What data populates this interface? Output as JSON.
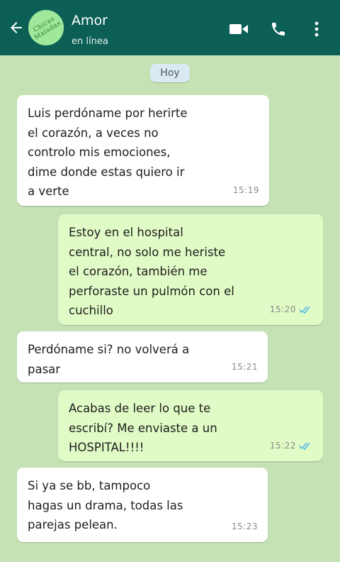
{
  "header": {
    "contact_name": "Amor",
    "status": "en línea",
    "avatar_text": "Chicas\nMaladas",
    "icons": {
      "back": "back-arrow-icon",
      "video": "video-call-icon",
      "phone": "phone-icon",
      "menu": "more-vert-icon"
    }
  },
  "day_label": "Hoy",
  "messages": [
    {
      "direction": "in",
      "text": "Luis perdóname por herirte\nel corazón, a veces no\ncontrolo mis emociones,\ndime donde estas quiero ir\na verte",
      "time": "15:19"
    },
    {
      "direction": "out",
      "text": "Estoy en el hospital\ncentral, no solo me heriste\nel corazón, también me\nperforaste un pulmón con el\ncuchillo",
      "time": "15:20",
      "read": true
    },
    {
      "direction": "in",
      "text": "Perdóname si? no volverá a\npasar",
      "time": "15:21"
    },
    {
      "direction": "out",
      "text": "Acabas de leer lo que te\nescribí? Me enviaste a un\nHOSPITAL!!!!",
      "time": "15:22",
      "read": true
    },
    {
      "direction": "in",
      "text": "Si ya se bb, tampoco\nhagas un drama, todas las\nparejas pelean.",
      "time": "15:23"
    }
  ],
  "colors": {
    "header": "#0c5f55",
    "chat_background": "#c4e2b4",
    "incoming_bubble": "#ffffff",
    "outgoing_bubble": "#e1fbc6",
    "read_ticks": "#4fb6ec"
  }
}
